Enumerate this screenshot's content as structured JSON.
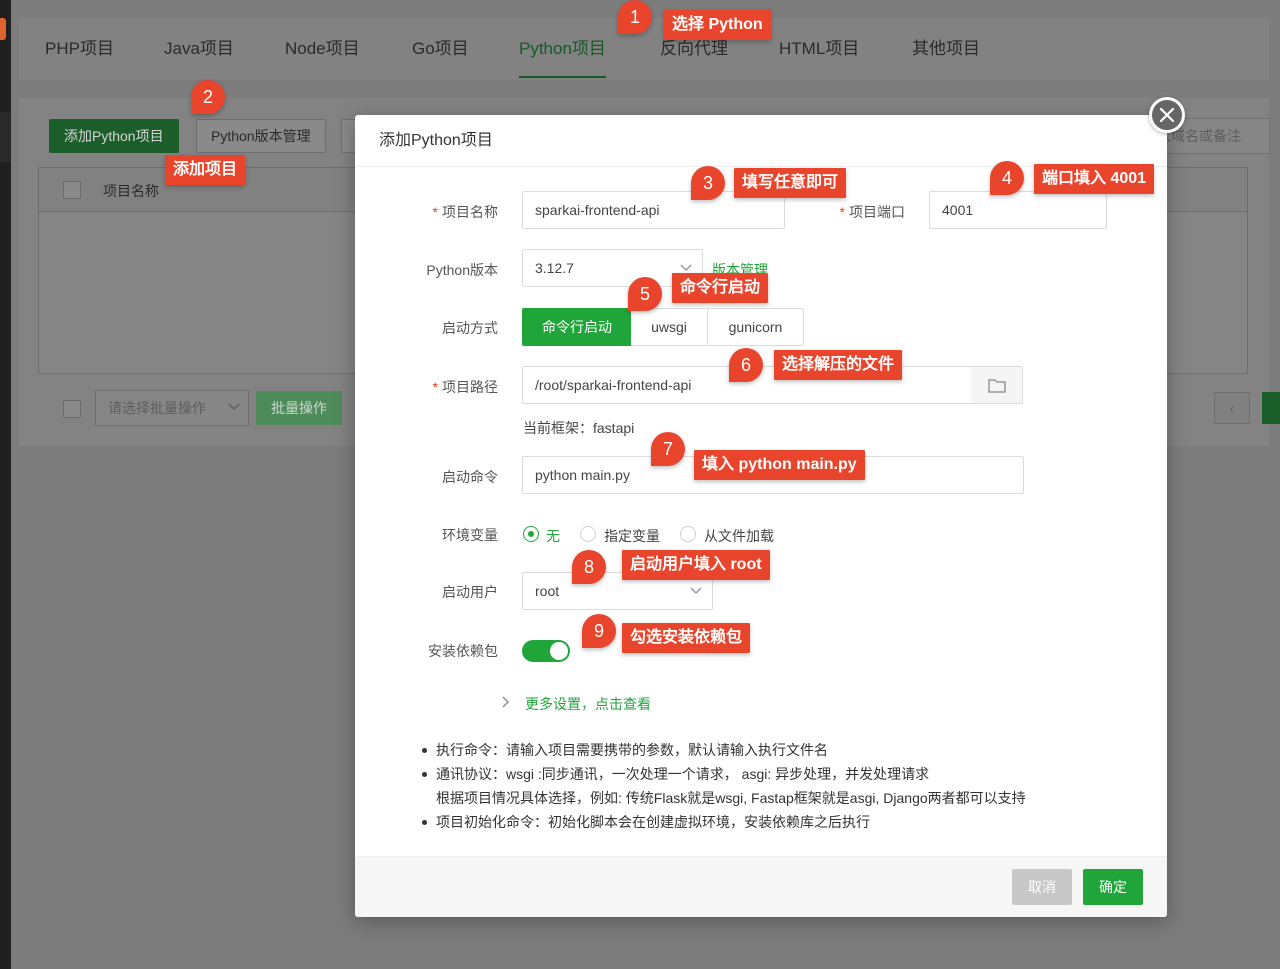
{
  "tabs": [
    "PHP项目",
    "Java项目",
    "Node项目",
    "Go项目",
    "Python项目",
    "反向代理",
    "HTML项目",
    "其他项目"
  ],
  "active_tab": "Python项目",
  "toolbar": {
    "add_button": "添加Python项目",
    "version_button": "Python版本管理",
    "search_placeholder": "入域名或备注"
  },
  "table": {
    "col_name": "项目名称"
  },
  "batch": {
    "select_placeholder": "请选择批量操作",
    "button": "批量操作"
  },
  "pager": {
    "prev": "‹"
  },
  "modal": {
    "title": "添加Python项目",
    "name_label": "项目名称",
    "name_value": "sparkai-frontend-api",
    "port_label": "项目端口",
    "port_value": "4001",
    "version_label": "Python版本",
    "version_value": "3.12.7",
    "version_link": "版本管理",
    "start_mode_label": "启动方式",
    "start_modes": [
      "命令行启动",
      "uwsgi",
      "gunicorn"
    ],
    "path_label": "项目路径",
    "path_value": "/root/sparkai-frontend-api",
    "framework_text": "当前框架：fastapi",
    "command_label": "启动命令",
    "command_value": "python main.py",
    "env_label": "环境变量",
    "env_options": [
      "无",
      "指定变量",
      "从文件加载"
    ],
    "user_label": "启动用户",
    "user_value": "root",
    "deps_label": "安装依赖包",
    "more_settings": "更多设置，点击查看",
    "tips": [
      "执行命令：请输入项目需要携带的参数，默认请输入执行文件名",
      "通讯协议：wsgi :同步通讯，一次处理一个请求， asgi: 异步处理，并发处理请求",
      "根据项目情况具体选择，例如: 传统Flask就是wsgi, Fastap框架就是asgi, Django两者都可以支持",
      "项目初始化命令：初始化脚本会在创建虚拟环境，安装依赖库之后执行"
    ],
    "cancel": "取消",
    "ok": "确定"
  },
  "annotations": [
    {
      "num": "1",
      "text": "选择 Python"
    },
    {
      "num": "2",
      "text": "添加项目"
    },
    {
      "num": "3",
      "text": "填写任意即可"
    },
    {
      "num": "4",
      "text": "端口填入 4001"
    },
    {
      "num": "5",
      "text": "命令行启动"
    },
    {
      "num": "6",
      "text": "选择解压的文件"
    },
    {
      "num": "7",
      "text": "填入 python main.py"
    },
    {
      "num": "8",
      "text": "启动用户填入 root"
    },
    {
      "num": "9",
      "text": "勾选安装依赖包"
    }
  ],
  "colors": {
    "accent": "#20a53a",
    "annotation": "#e8452c"
  }
}
